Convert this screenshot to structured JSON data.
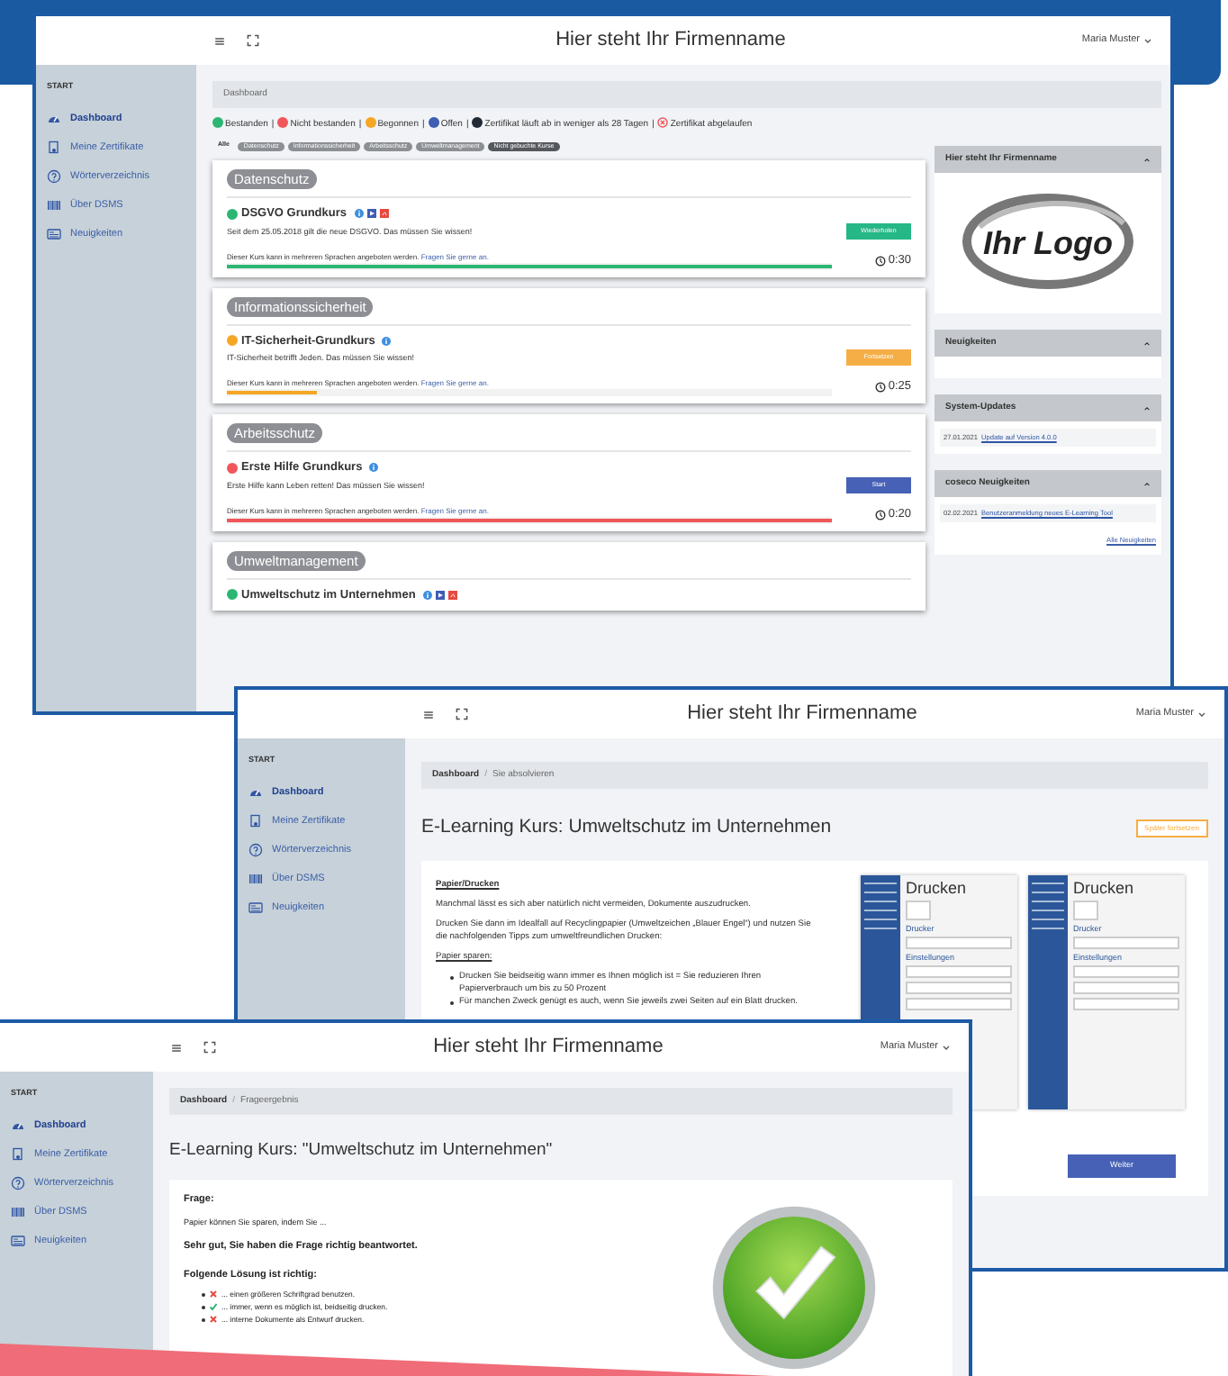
{
  "windows": [
    {
      "kind": "dashboard",
      "header": {
        "title": "Hier steht Ihr Firmenname",
        "user": "Maria Muster"
      },
      "sidebar": {
        "section": "START",
        "items": [
          {
            "label": "Dashboard",
            "selected": true
          },
          {
            "label": "Meine Zertifikate",
            "selected": false
          },
          {
            "label": "Wörterverzeichnis",
            "selected": false
          },
          {
            "label": "Über DSMS",
            "selected": false
          },
          {
            "label": "Neuigkeiten",
            "selected": false
          }
        ]
      },
      "breadcrumb": [
        "Dashboard"
      ],
      "legend": {
        "separator": "|",
        "items": [
          {
            "kind": "dot",
            "label": "Bestanden",
            "color": "#2bb673"
          },
          {
            "kind": "dot",
            "label": "Nicht bestanden",
            "color": "#f0565a"
          },
          {
            "kind": "dot",
            "label": "Begonnen",
            "color": "#f5a623"
          },
          {
            "kind": "dot",
            "label": "Offen",
            "color": "#3f5db3"
          },
          {
            "kind": "dot",
            "label": "Zertifikat läuft ab in weniger als 28 Tagen",
            "color": "#222a33"
          },
          {
            "kind": "expired",
            "label": "Zertifikat abgelaufen"
          }
        ]
      },
      "filters": [
        {
          "label": "Alle",
          "selected": true,
          "kind": "all"
        },
        {
          "label": "Datenschutz",
          "selected": false,
          "kind": "category"
        },
        {
          "label": "Informationssicherheit",
          "selected": false,
          "kind": "category"
        },
        {
          "label": "Arbeitsschutz",
          "selected": false,
          "kind": "category"
        },
        {
          "label": "Umweltmanagement",
          "selected": false,
          "kind": "category"
        },
        {
          "label": "Nicht gebuchte Kurse",
          "selected": false,
          "kind": "unbooked"
        }
      ],
      "courses": [
        {
          "category": "Datenschutz",
          "title": "DSGVO Grundkurs",
          "color": "#2bb673",
          "badges": [
            {
              "kind": "info"
            },
            {
              "kind": "play"
            },
            {
              "kind": "pdf"
            }
          ],
          "description": "Seit dem 25.05.2018 gilt die neue DSGVO. Das müssen Sie wissen!",
          "note": "Dieser Kurs kann in mehreren Sprachen angeboten werden.",
          "note_link": "Fragen Sie gerne an.",
          "button": {
            "label": "Wiederholen",
            "kind": "repeat"
          },
          "level": 1,
          "duration": "0:30"
        },
        {
          "category": "Informationssicherheit",
          "title": "IT-Sicherheit-Grundkurs",
          "color": "#f5a623",
          "badges": [
            {
              "kind": "info"
            }
          ],
          "description": "IT-Sicherheit betrifft Jeden. Das müssen Sie wissen!",
          "note": "Dieser Kurs kann in mehreren Sprachen angeboten werden.",
          "note_link": "Fragen Sie gerne an.",
          "button": {
            "label": "Fortsetzen",
            "kind": "continue"
          },
          "level": 0.15,
          "duration": "0:25"
        },
        {
          "category": "Arbeitsschutz",
          "title": "Erste Hilfe Grundkurs",
          "color": "#f0565a",
          "badges": [
            {
              "kind": "info"
            }
          ],
          "description": "Erste Hilfe kann Leben retten! Das müssen Sie wissen!",
          "note": "Dieser Kurs kann in mehreren Sprachen angeboten werden.",
          "note_link": "Fragen Sie gerne an.",
          "button": {
            "label": "Start",
            "kind": "start"
          },
          "level": 1,
          "duration": "0:20"
        },
        {
          "category": "Umweltmanagement",
          "title": "Umweltschutz im Unternehmen",
          "color": "#2bb673",
          "badges": [
            {
              "kind": "info"
            },
            {
              "kind": "play"
            },
            {
              "kind": "pdf"
            }
          ]
        }
      ],
      "panels": [
        {
          "title": "Hier steht Ihr Firmenname",
          "expanded": true,
          "kind": "logo",
          "logo": "Ihr Logo"
        },
        {
          "title": "Neuigkeiten",
          "expanded": true,
          "kind": "news"
        },
        {
          "title": "System-Updates",
          "expanded": true,
          "kind": "news",
          "entries": [
            {
              "date": "27.01.2021",
              "link": "Update auf Version 4.0.0"
            }
          ]
        },
        {
          "title": "coseco Neuigkeiten",
          "expanded": true,
          "kind": "news",
          "entries": [
            {
              "date": "02.02.2021",
              "link": "Benutzeranmeldung neues E-Learning Tool"
            }
          ],
          "more": "Alle Neuigkeiten"
        }
      ]
    },
    {
      "kind": "lesson",
      "header": {
        "title": "Hier steht Ihr Firmenname",
        "user": "Maria Muster"
      },
      "sidebar": {
        "section": "START",
        "items": [
          {
            "label": "Dashboard",
            "selected": true
          },
          {
            "label": "Meine Zertifikate",
            "selected": false
          },
          {
            "label": "Wörterverzeichnis",
            "selected": false
          },
          {
            "label": "Über DSMS",
            "selected": false
          },
          {
            "label": "Neuigkeiten",
            "selected": false
          }
        ]
      },
      "breadcrumb": [
        "Dashboard",
        "Sie absolvieren"
      ],
      "breadcrumb_separator": "/",
      "title": "E-Learning Kurs: Umweltschutz im Unternehmen",
      "action": "Später fortsetzen",
      "heading": "Papier/Drucken",
      "paragraphs": [
        "Manchmal lässt es sich aber natürlich nicht vermeiden, Dokumente auszudrucken.",
        "Drucken Sie dann im Idealfall auf Recyclingpapier (Umweltzeichen „Blauer Engel“) und nutzen Sie die nachfolgenden Tipps zum umweltfreundlichen Drucken:"
      ],
      "subheading": "Papier sparen:",
      "bullets": [
        "Drucken Sie beidseitig wann immer es Ihnen möglich ist = Sie reduzieren Ihren Papierverbrauch um bis zu 50 Prozent",
        "Für manchen Zweck genügt es auch, wenn Sie jeweils zwei Seiten auf ein Blatt drucken."
      ],
      "dialogs": [
        {
          "title": "Drucken",
          "sections": [
            "Drucker",
            "Einstellungen"
          ]
        },
        {
          "title": "Drucken",
          "sections": [
            "Drucker",
            "Einstellungen"
          ]
        }
      ],
      "next": "Weiter"
    },
    {
      "kind": "result",
      "header": {
        "title": "Hier steht Ihr Firmenname",
        "user": "Maria Muster"
      },
      "sidebar": {
        "section": "START",
        "items": [
          {
            "label": "Dashboard",
            "selected": true
          },
          {
            "label": "Meine Zertifikate",
            "selected": false
          },
          {
            "label": "Wörterverzeichnis",
            "selected": false
          },
          {
            "label": "Über DSMS",
            "selected": false
          },
          {
            "label": "Neuigkeiten",
            "selected": false
          }
        ]
      },
      "breadcrumb": [
        "Dashboard",
        "Frageergebnis"
      ],
      "breadcrumb_separator": "/",
      "title": "E-Learning Kurs: \"Umweltschutz im Unternehmen\"",
      "question_label": "Frage:",
      "question": "Papier können Sie sparen, indem Sie ...",
      "feedback": "Sehr gut, Sie haben die Frage richtig beantwortet.",
      "solution_label": "Folgende Lösung ist richtig:",
      "options": [
        {
          "text": "... einen größeren Schriftgrad benutzen.",
          "correct": false
        },
        {
          "text": "... immer, wenn es möglich ist, beidseitig drucken.",
          "correct": true
        },
        {
          "text": "... interne Dokumente als Entwurf drucken.",
          "correct": false
        }
      ]
    }
  ]
}
